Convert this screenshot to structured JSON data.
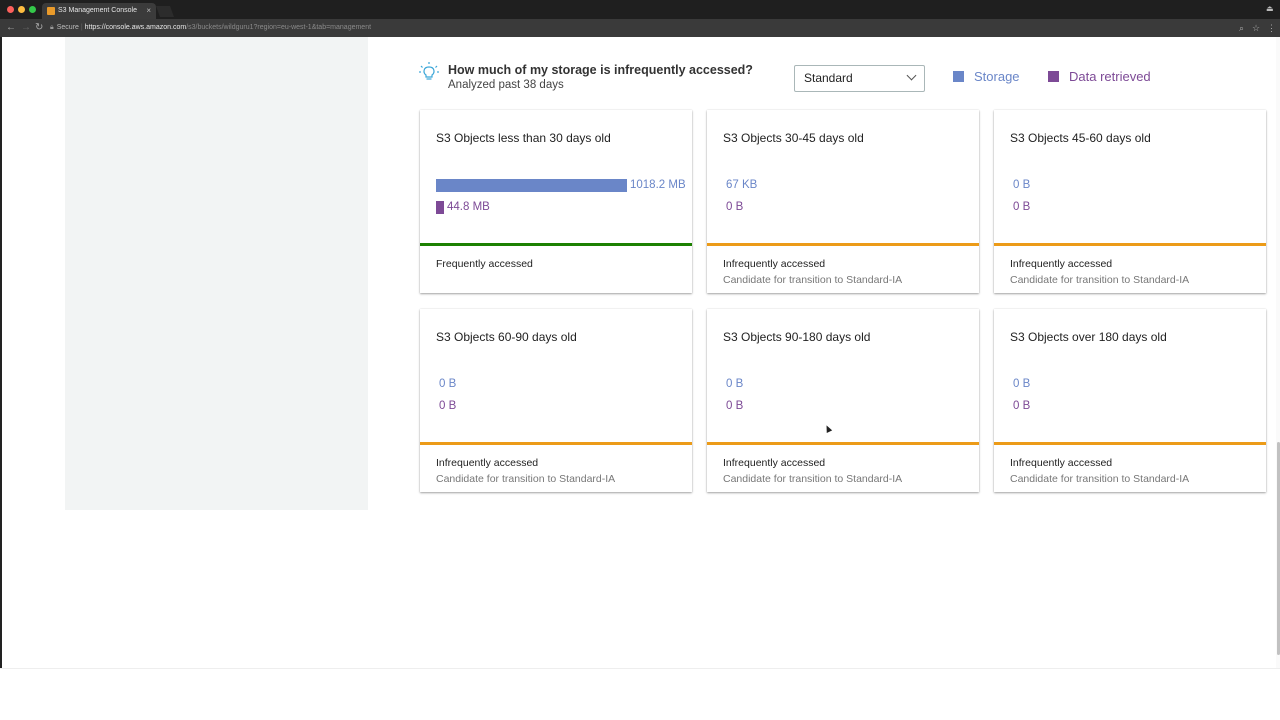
{
  "browser": {
    "tab_title": "S3 Management Console",
    "tab_close": "×",
    "secure_label": "Secure",
    "url_host": "https://console.aws.amazon.com",
    "url_path": "/s3/buckets/wildguru1?region=eu-west-1&tab=management",
    "icons": [
      "back-icon",
      "forward-icon",
      "reload-icon",
      "lock-icon",
      "zoom-icon",
      "star-icon",
      "menu-icon"
    ]
  },
  "header": {
    "question": "How much of my storage is infrequently accessed?",
    "subtitle": "Analyzed past 38 days",
    "storage_class_selected": "Standard",
    "legend": [
      {
        "label": "Storage",
        "color": "#6a86c8"
      },
      {
        "label": "Data retrieved",
        "color": "#7d4a96"
      }
    ]
  },
  "colors": {
    "storage": "#6a86c8",
    "retrieved": "#7d4a96",
    "frequent_bar": "#1d8102",
    "infrequent_bar": "#ec9b18"
  },
  "cards": [
    {
      "title": "S3 Objects less than 30 days old",
      "storage": "1018.2 MB",
      "retrieved": "44.8 MB",
      "status": "Frequently accessed",
      "note": ""
    },
    {
      "title": "S3 Objects 30-45 days old",
      "storage": "67 KB",
      "retrieved": "0 B",
      "status": "Infrequently accessed",
      "note": "Candidate for transition to Standard-IA"
    },
    {
      "title": "S3 Objects 45-60 days old",
      "storage": "0 B",
      "retrieved": "0 B",
      "status": "Infrequently accessed",
      "note": "Candidate for transition to Standard-IA"
    },
    {
      "title": "S3 Objects 60-90 days old",
      "storage": "0 B",
      "retrieved": "0 B",
      "status": "Infrequently accessed",
      "note": "Candidate for transition to Standard-IA"
    },
    {
      "title": "S3 Objects 90-180 days old",
      "storage": "0 B",
      "retrieved": "0 B",
      "status": "Infrequently accessed",
      "note": "Candidate for transition to Standard-IA"
    },
    {
      "title": "S3 Objects over 180 days old",
      "storage": "0 B",
      "retrieved": "0 B",
      "status": "Infrequently accessed",
      "note": "Candidate for transition to Standard-IA"
    }
  ]
}
